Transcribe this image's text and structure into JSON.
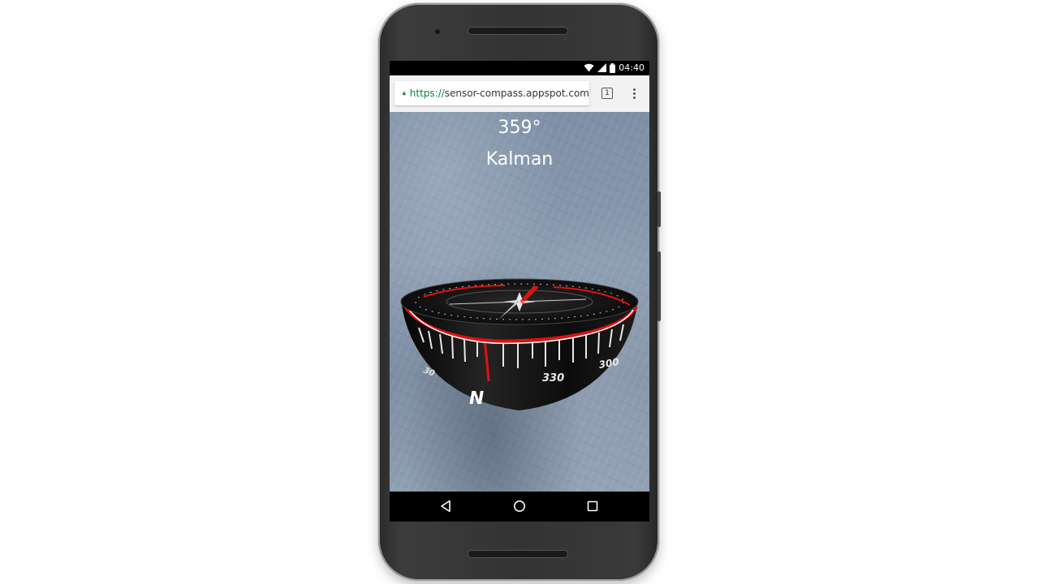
{
  "status_bar": {
    "time": "04:40",
    "icons": [
      "wifi-icon",
      "cell-signal-icon",
      "battery-icon"
    ]
  },
  "browser": {
    "url_scheme": "https://",
    "url_host": "sensor-compass.appspot.com",
    "tab_count": "1",
    "icons": [
      "lock-icon",
      "overflow-menu-icon"
    ]
  },
  "compass_app": {
    "heading": "359°",
    "filter": "Kalman",
    "dial_labels": [
      "N",
      "330",
      "300",
      "30"
    ]
  },
  "nav_bar": {
    "icons": [
      "back-icon",
      "home-icon",
      "recents-icon"
    ]
  },
  "colors": {
    "url_scheme": "#0b8043",
    "compass_accent": "#e01010",
    "compass_body": "#0a0a0a"
  }
}
